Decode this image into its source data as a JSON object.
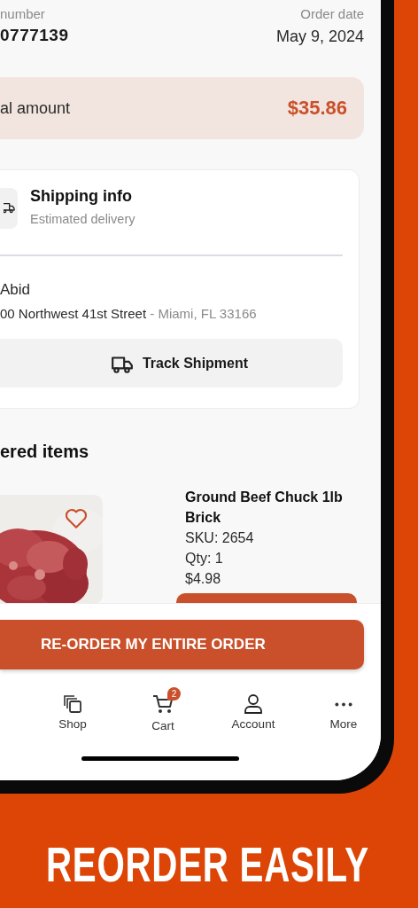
{
  "order": {
    "number_label": "number",
    "number": "0777139",
    "date_label": "Order date",
    "date": "May 9, 2024"
  },
  "total": {
    "label": "al amount",
    "amount": "$35.86"
  },
  "shipping": {
    "title": "Shipping info",
    "subtitle": "Estimated delivery",
    "name": "Abid",
    "street": "00 Northwest 41st Street",
    "separator": "-",
    "city": "Miami, FL 33166",
    "track_button": "Track Shipment"
  },
  "items_heading": "ered items",
  "items": [
    {
      "kind": "picture",
      "favorite": false,
      "name": "Ground Beef Chuck 1lb Brick",
      "sku": "SKU: 2654",
      "qty": "Qty: 1",
      "price": "$4.98"
    }
  ],
  "reorder_button": "RE-ORDER MY ENTIRE ORDER",
  "nav": [
    {
      "kind": "shop",
      "label": "Shop"
    },
    {
      "kind": "cart",
      "label": "Cart",
      "badge": "2"
    },
    {
      "kind": "account",
      "label": "Account"
    },
    {
      "kind": "more",
      "label": "More"
    }
  ],
  "caption": "REORDER EASILY"
}
